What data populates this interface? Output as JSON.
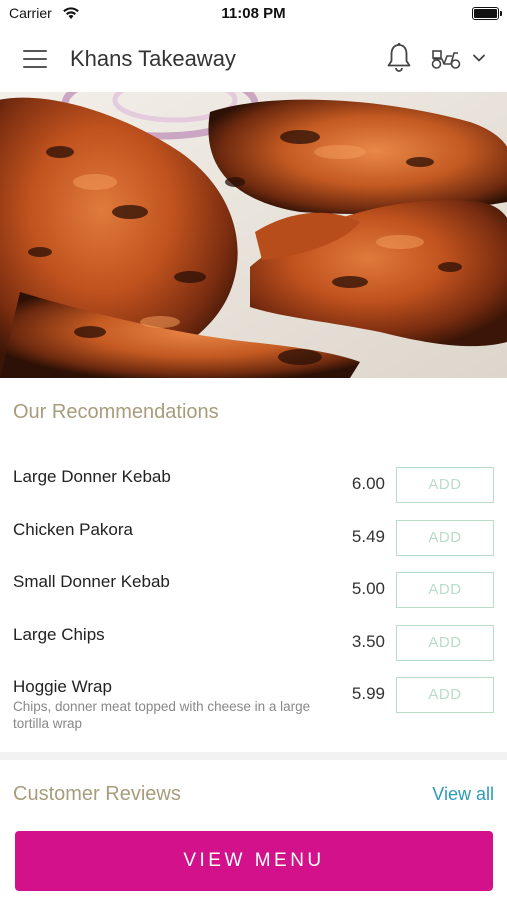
{
  "status_bar": {
    "carrier": "Carrier",
    "time": "11:08 PM"
  },
  "header": {
    "title": "Khans Takeaway",
    "icons": [
      "menu-icon",
      "bell-icon",
      "scooter-icon",
      "chevron-down-icon"
    ]
  },
  "hero": {
    "image": "grilled-tandoori-chicken"
  },
  "recommendations": {
    "title": "Our Recommendations",
    "items": [
      {
        "name": "Large Donner Kebab",
        "description": "",
        "price": "6.00",
        "add_label": "ADD"
      },
      {
        "name": "Chicken Pakora",
        "description": "",
        "price": "5.49",
        "add_label": "ADD"
      },
      {
        "name": "Small Donner Kebab",
        "description": "",
        "price": "5.00",
        "add_label": "ADD"
      },
      {
        "name": "Large Chips",
        "description": "",
        "price": "3.50",
        "add_label": "ADD"
      },
      {
        "name": "Hoggie Wrap",
        "description": "Chips, donner meat topped with cheese in a large tortilla wrap",
        "price": "5.99",
        "add_label": "ADD"
      }
    ]
  },
  "reviews": {
    "title": "Customer Reviews",
    "view_all": "View all"
  },
  "cta": {
    "view_menu": "VIEW MENU"
  },
  "colors": {
    "accent": "#d2118a",
    "section_title": "#a89c7c",
    "add_button": "#b9dcc8",
    "link": "#2d9ab8"
  }
}
